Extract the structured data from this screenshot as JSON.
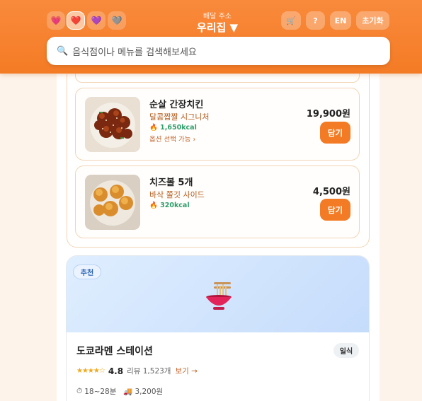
{
  "header": {
    "address_label": "배달 주소",
    "address_value": "우리집 ▼",
    "language_button": "EN",
    "reset_button": "초기화",
    "help_button": "?",
    "theme_icons": [
      "heart-pink-icon",
      "heart-red-icon",
      "heart-purple-icon",
      "heart-gray-icon"
    ]
  },
  "search": {
    "placeholder": "음식점이나 메뉴를 검색해보세요"
  },
  "menu_items": [
    {
      "name": "순살 간장치킨",
      "description": "달콤짭짤 시그니처",
      "kcal": "1,650kcal",
      "option": "옵션 선택 가능 ›",
      "price": "19,900원",
      "add_label": "담기"
    },
    {
      "name": "치즈볼 5개",
      "description": "바삭 쫄깃 사이드",
      "kcal": "320kcal",
      "price": "4,500원",
      "add_label": "담기"
    }
  ],
  "restaurant": {
    "badge": "추천",
    "name": "도쿄라멘 스테이션",
    "cuisine": "일식",
    "stars": "★★★★☆",
    "rating": "4.8",
    "reviews": "리뷰 1,523개",
    "review_link": "보기 →",
    "delivery_time": "18~28분",
    "delivery_fee": "3,200원"
  },
  "colors": {
    "accent": "#f47b25",
    "kcal_green": "#2f9e6a"
  }
}
